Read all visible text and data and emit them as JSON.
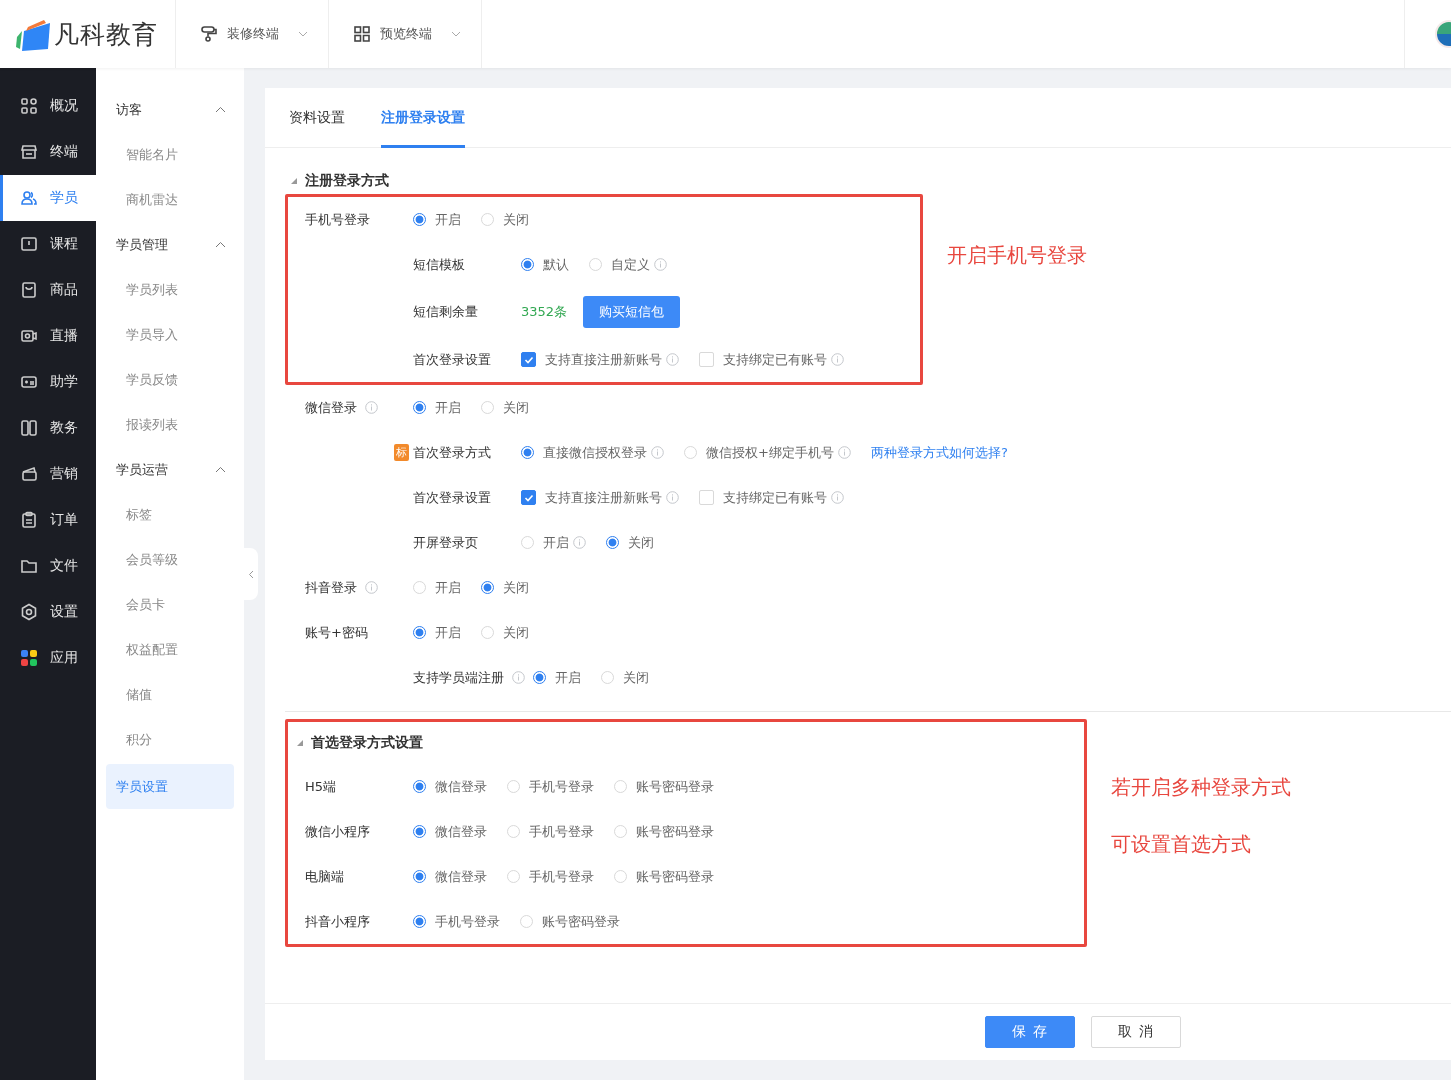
{
  "header": {
    "logo_text": "凡科教育",
    "menus": [
      {
        "kind": "paint",
        "label": "装修终端"
      },
      {
        "kind": "qr",
        "label": "预览终端"
      }
    ]
  },
  "nav": [
    {
      "label": "概况",
      "selected": false
    },
    {
      "label": "终端",
      "selected": false
    },
    {
      "label": "学员",
      "selected": true
    },
    {
      "label": "课程",
      "selected": false
    },
    {
      "label": "商品",
      "selected": false
    },
    {
      "label": "直播",
      "selected": false
    },
    {
      "label": "助学",
      "selected": false
    },
    {
      "label": "教务",
      "selected": false
    },
    {
      "label": "营销",
      "selected": false
    },
    {
      "label": "订单",
      "selected": false
    },
    {
      "label": "文件",
      "selected": false
    },
    {
      "label": "设置",
      "selected": false
    },
    {
      "label": "应用",
      "selected": false
    }
  ],
  "submenu": [
    {
      "kind": "group",
      "label": "访客",
      "expanded": true,
      "children": [
        {
          "label": "智能名片",
          "selected": false
        },
        {
          "label": "商机雷达",
          "selected": false
        }
      ]
    },
    {
      "kind": "group",
      "label": "学员管理",
      "expanded": true,
      "children": [
        {
          "label": "学员列表",
          "selected": false
        },
        {
          "label": "学员导入",
          "selected": false
        },
        {
          "label": "学员反馈",
          "selected": false
        },
        {
          "label": "报读列表",
          "selected": false
        }
      ]
    },
    {
      "kind": "group",
      "label": "学员运营",
      "expanded": true,
      "children": [
        {
          "label": "标签",
          "selected": false
        },
        {
          "label": "会员等级",
          "selected": false
        },
        {
          "label": "会员卡",
          "selected": false
        },
        {
          "label": "权益配置",
          "selected": false
        },
        {
          "label": "储值",
          "selected": false
        },
        {
          "label": "积分",
          "selected": false
        }
      ]
    },
    {
      "kind": "item",
      "label": "学员设置",
      "selected": true
    }
  ],
  "tabs": [
    {
      "label": "资料设置",
      "selected": false
    },
    {
      "label": "注册登录设置",
      "selected": true
    }
  ],
  "sections": [
    {
      "title": "注册登录方式",
      "highlight": false,
      "rows": [
        {
          "label": "手机号登录",
          "kind": "radio",
          "highlight": true,
          "note": [
            "开启手机号登录"
          ],
          "options": [
            {
              "label": "开启",
              "selected": true
            },
            {
              "label": "关闭",
              "selected": false
            }
          ],
          "children": [
            {
              "label": "短信模板",
              "kind": "radio",
              "options": [
                {
                  "label": "默认",
                  "selected": true
                },
                {
                  "label": "自定义",
                  "selected": false,
                  "info": true
                }
              ]
            },
            {
              "label": "短信剩余量",
              "kind": "quota",
              "count": "3352条",
              "button": "购买短信包"
            },
            {
              "label": "首次登录设置",
              "kind": "checkbox",
              "options": [
                {
                  "label": "支持直接注册新账号",
                  "checked": true,
                  "info": true
                },
                {
                  "label": "支持绑定已有账号",
                  "checked": false,
                  "info": true
                }
              ]
            }
          ]
        },
        {
          "label": "微信登录",
          "info": true,
          "kind": "radio",
          "options": [
            {
              "label": "开启",
              "selected": true
            },
            {
              "label": "关闭",
              "selected": false
            }
          ],
          "children": [
            {
              "label": "首次登录方式",
              "tag": "标",
              "kind": "radio",
              "link": "两种登录方式如何选择?",
              "options": [
                {
                  "label": "直接微信授权登录",
                  "selected": true,
                  "info": true
                },
                {
                  "label": "微信授权+绑定手机号",
                  "selected": false,
                  "info": true
                }
              ]
            },
            {
              "label": "首次登录设置",
              "kind": "checkbox",
              "options": [
                {
                  "label": "支持直接注册新账号",
                  "checked": true,
                  "info": true
                },
                {
                  "label": "支持绑定已有账号",
                  "checked": false,
                  "info": true
                }
              ]
            },
            {
              "label": "开屏登录页",
              "kind": "radio",
              "options": [
                {
                  "label": "开启",
                  "selected": false,
                  "info": true
                },
                {
                  "label": "关闭",
                  "selected": true
                }
              ]
            }
          ]
        },
        {
          "label": "抖音登录",
          "info": true,
          "kind": "radio",
          "options": [
            {
              "label": "开启",
              "selected": false
            },
            {
              "label": "关闭",
              "selected": true
            }
          ]
        },
        {
          "label": "账号+密码",
          "kind": "radio",
          "options": [
            {
              "label": "开启",
              "selected": true
            },
            {
              "label": "关闭",
              "selected": false
            }
          ],
          "children": [
            {
              "label": "支持学员端注册",
              "info": true,
              "kind": "radio",
              "options": [
                {
                  "label": "开启",
                  "selected": true
                },
                {
                  "label": "关闭",
                  "selected": false
                }
              ]
            }
          ]
        }
      ]
    },
    {
      "title": "首选登录方式设置",
      "highlight": true,
      "note": [
        "若开启多种登录方式",
        "可设置首选方式"
      ],
      "rows": [
        {
          "label": "H5端",
          "kind": "radio",
          "options": [
            {
              "label": "微信登录",
              "selected": true
            },
            {
              "label": "手机号登录",
              "selected": false
            },
            {
              "label": "账号密码登录",
              "selected": false
            }
          ]
        },
        {
          "label": "微信小程序",
          "kind": "radio",
          "options": [
            {
              "label": "微信登录",
              "selected": true
            },
            {
              "label": "手机号登录",
              "selected": false
            },
            {
              "label": "账号密码登录",
              "selected": false
            }
          ]
        },
        {
          "label": "电脑端",
          "kind": "radio",
          "options": [
            {
              "label": "微信登录",
              "selected": true
            },
            {
              "label": "手机号登录",
              "selected": false
            },
            {
              "label": "账号密码登录",
              "selected": false
            }
          ]
        },
        {
          "label": "抖音小程序",
          "kind": "radio",
          "options": [
            {
              "label": "手机号登录",
              "selected": true
            },
            {
              "label": "账号密码登录",
              "selected": false
            }
          ]
        }
      ]
    }
  ],
  "footer": {
    "buttons": [
      {
        "kind": "primary",
        "label": "保 存"
      },
      {
        "kind": "default",
        "label": "取 消"
      }
    ]
  }
}
